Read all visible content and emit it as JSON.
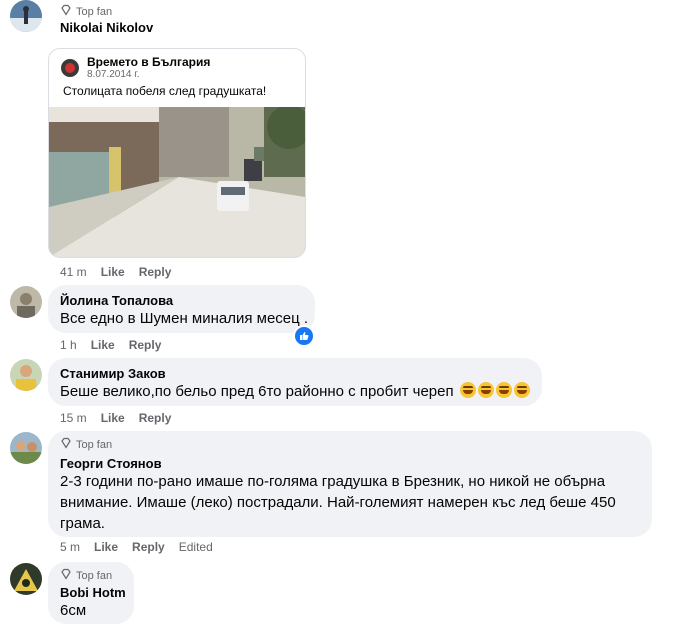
{
  "comments": [
    {
      "badge": "Top fan",
      "author": "Nikolai Nikolov",
      "shared_post": {
        "page_name": "Времето в България",
        "date": "8.07.2014 г.",
        "text": "Столицата побеля след градушката!"
      },
      "time": "41 m",
      "like": "Like",
      "reply": "Reply"
    },
    {
      "author": "Йолина Топалова",
      "text": "Все едно в Шумен миналия месец .",
      "time": "1 h",
      "like": "Like",
      "reply": "Reply"
    },
    {
      "author": "Станимир Заков",
      "text": "Беше велико,по бельо пред 6то районно с пробит череп",
      "time": "15 m",
      "like": "Like",
      "reply": "Reply"
    },
    {
      "badge": "Top fan",
      "author": "Георги Стоянов",
      "text_lines": [
        "2-3 години по-рано имаше по-голяма градушка в Брезник, но никой не обърна",
        "внимание. Имаше (леко) пострадали. Най-големият намерен къс лед беше 450",
        "грама."
      ],
      "time": "5 m",
      "like": "Like",
      "reply": "Reply",
      "edited": "Edited"
    },
    {
      "badge": "Top fan",
      "author": "Bobi Hotm",
      "text": "6см"
    }
  ],
  "colors": {
    "bubble": "#f0f2f5",
    "meta": "#65676b",
    "like_blue": "#1877f2"
  }
}
